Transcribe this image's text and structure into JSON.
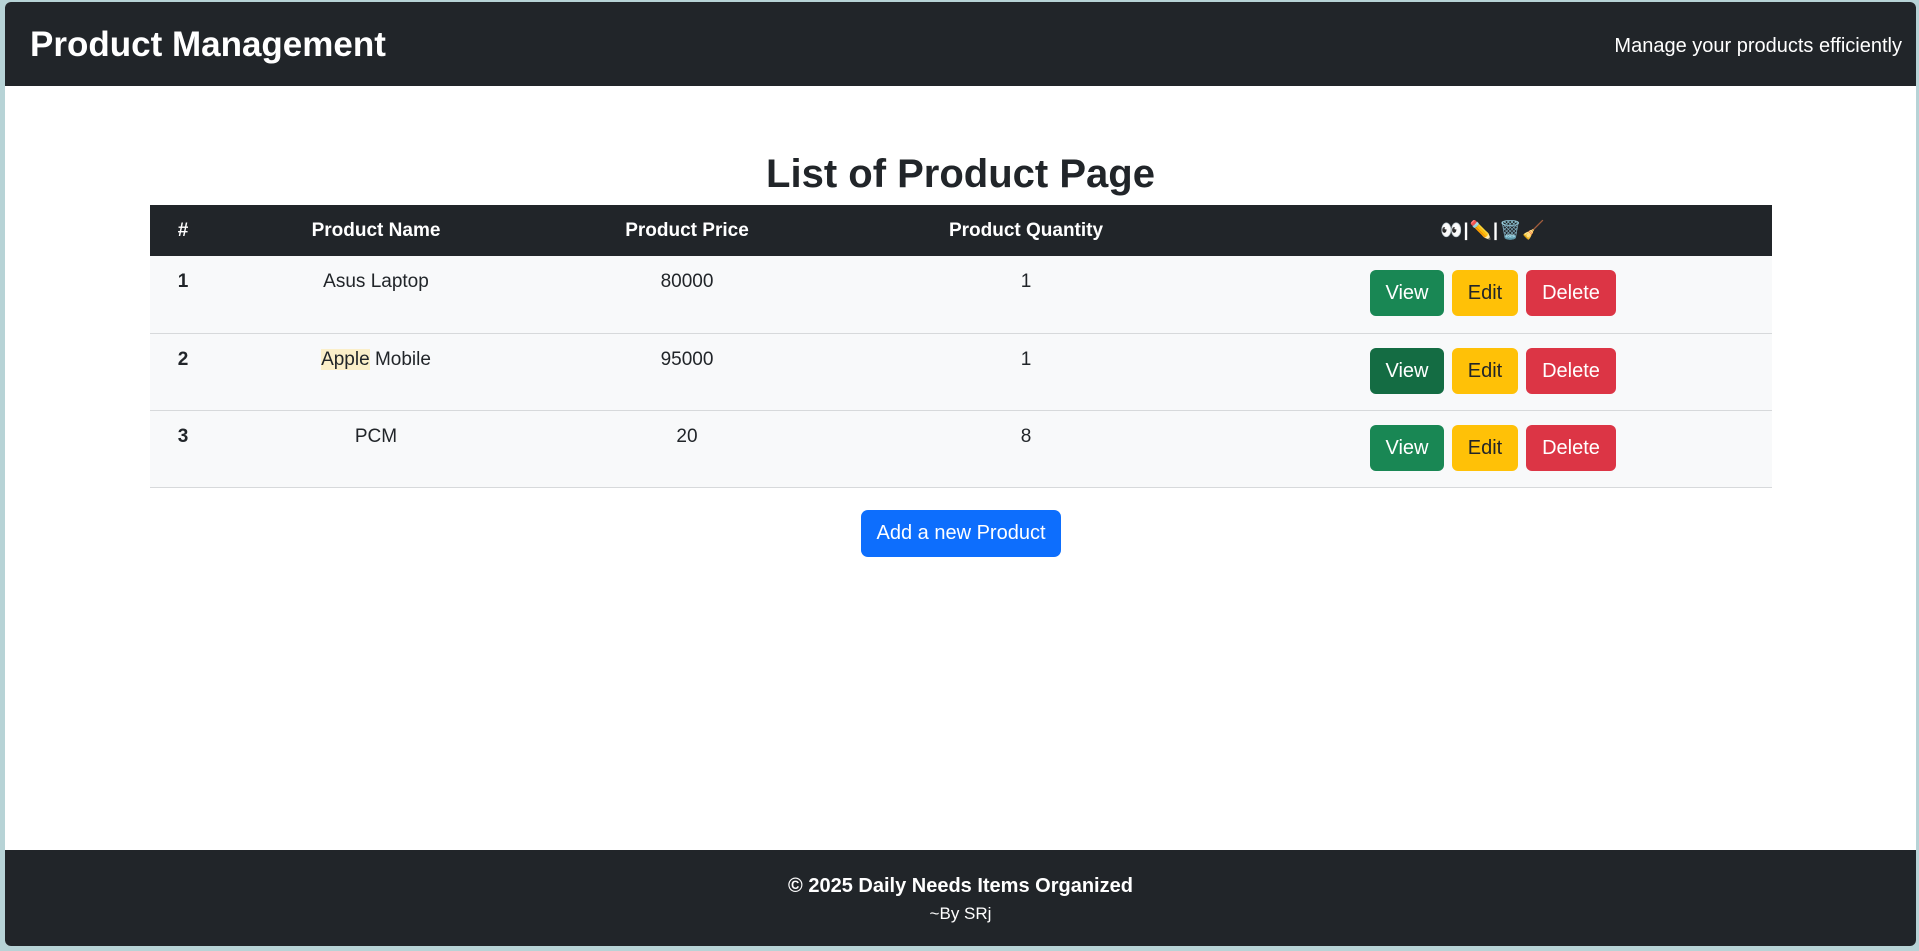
{
  "header": {
    "brand": "Product Management",
    "tagline": "Manage your products efficiently"
  },
  "main": {
    "title": "List of Product Page",
    "table": {
      "columns": [
        "#",
        "Product Name",
        "Product Price",
        "Product Quantity",
        "👀|✏️|🗑️🧹"
      ],
      "rows": [
        {
          "index": "1",
          "name": "Asus Laptop",
          "price": "80000",
          "quantity": "1"
        },
        {
          "index": "2",
          "name_highlight": "Apple",
          "name_rest": " Mobile",
          "price": "95000",
          "quantity": "1"
        },
        {
          "index": "3",
          "name": "PCM",
          "price": "20",
          "quantity": "8"
        }
      ]
    },
    "actions": {
      "view": "View",
      "edit": "Edit",
      "delete": "Delete"
    },
    "add_button": "Add a new Product"
  },
  "footer": {
    "copyright": "© 2025 Daily Needs Items Organized",
    "byline": "~By SRj"
  },
  "colors": {
    "navbar": "#212529",
    "view": "#198754",
    "edit": "#ffc107",
    "delete": "#dc3545",
    "primary": "#0d6efd"
  }
}
